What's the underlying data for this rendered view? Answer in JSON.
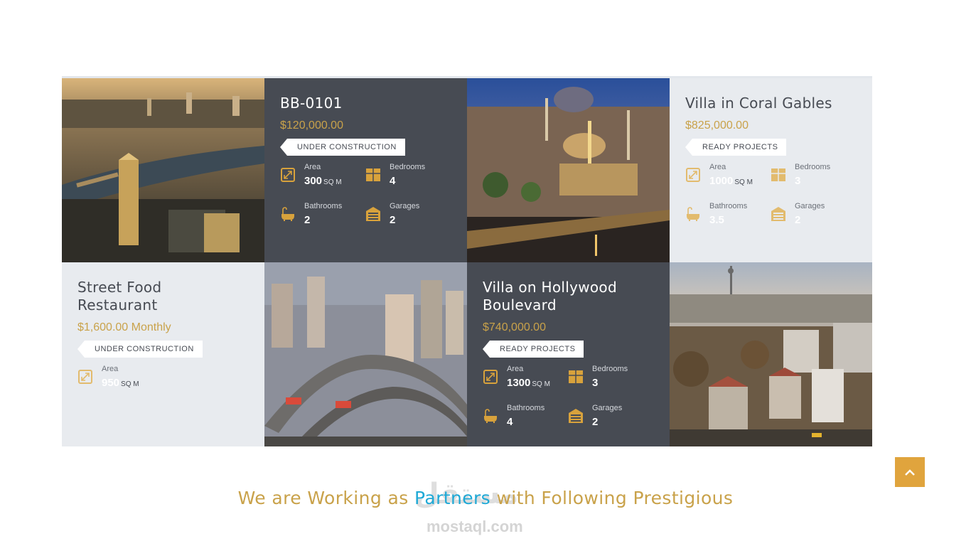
{
  "listings": [
    {
      "title": "BB-0101",
      "price": "$120,000.00",
      "status": "UNDER CONSTRUCTION",
      "specs": {
        "area": {
          "label": "Area",
          "value": "300",
          "unit": "SQ M"
        },
        "bedrooms": {
          "label": "Bedrooms",
          "value": "4"
        },
        "bathrooms": {
          "label": "Bathrooms",
          "value": "2"
        },
        "garages": {
          "label": "Garages",
          "value": "2"
        }
      }
    },
    {
      "title": "Villa in Coral Gables",
      "price": "$825,000.00",
      "status": "READY PROJECTS",
      "specs": {
        "area": {
          "label": "Area",
          "value": "1000",
          "unit": "SQ M"
        },
        "bedrooms": {
          "label": "Bedrooms",
          "value": "3"
        },
        "bathrooms": {
          "label": "Bathrooms",
          "value": "3.5"
        },
        "garages": {
          "label": "Garages",
          "value": "2"
        }
      }
    },
    {
      "title_line1": "Street Food",
      "title_line2": "Restaurant",
      "price": "$1,600.00 Monthly",
      "status": "UNDER CONSTRUCTION",
      "specs": {
        "area": {
          "label": "Area",
          "value": "950",
          "unit": "SQ M"
        }
      }
    },
    {
      "title_line1": "Villa on Hollywood",
      "title_line2": "Boulevard",
      "price": "$740,000.00",
      "status": "READY PROJECTS",
      "specs": {
        "area": {
          "label": "Area",
          "value": "1300",
          "unit": "SQ M"
        },
        "bedrooms": {
          "label": "Bedrooms",
          "value": "3"
        },
        "bathrooms": {
          "label": "Bathrooms",
          "value": "4"
        },
        "garages": {
          "label": "Garages",
          "value": "2"
        }
      }
    }
  ],
  "partners": {
    "before": "We are Working as ",
    "highlight": "Partners",
    "after": " with Following Prestigious"
  },
  "watermark": {
    "logo": "مستقل",
    "text": "mostaql.com"
  },
  "icons": {
    "area": "resize-arrow-icon",
    "bedrooms": "bed-icon",
    "bathrooms": "bathtub-icon",
    "garages": "garage-icon",
    "scroll_top": "chevron-up-icon"
  },
  "colors": {
    "accent": "#c9a24a",
    "dark_card": "#474b53",
    "light_card": "#e8ebef",
    "scroll_button": "#e0a43d",
    "partners_highlight": "#1fa9d6"
  }
}
